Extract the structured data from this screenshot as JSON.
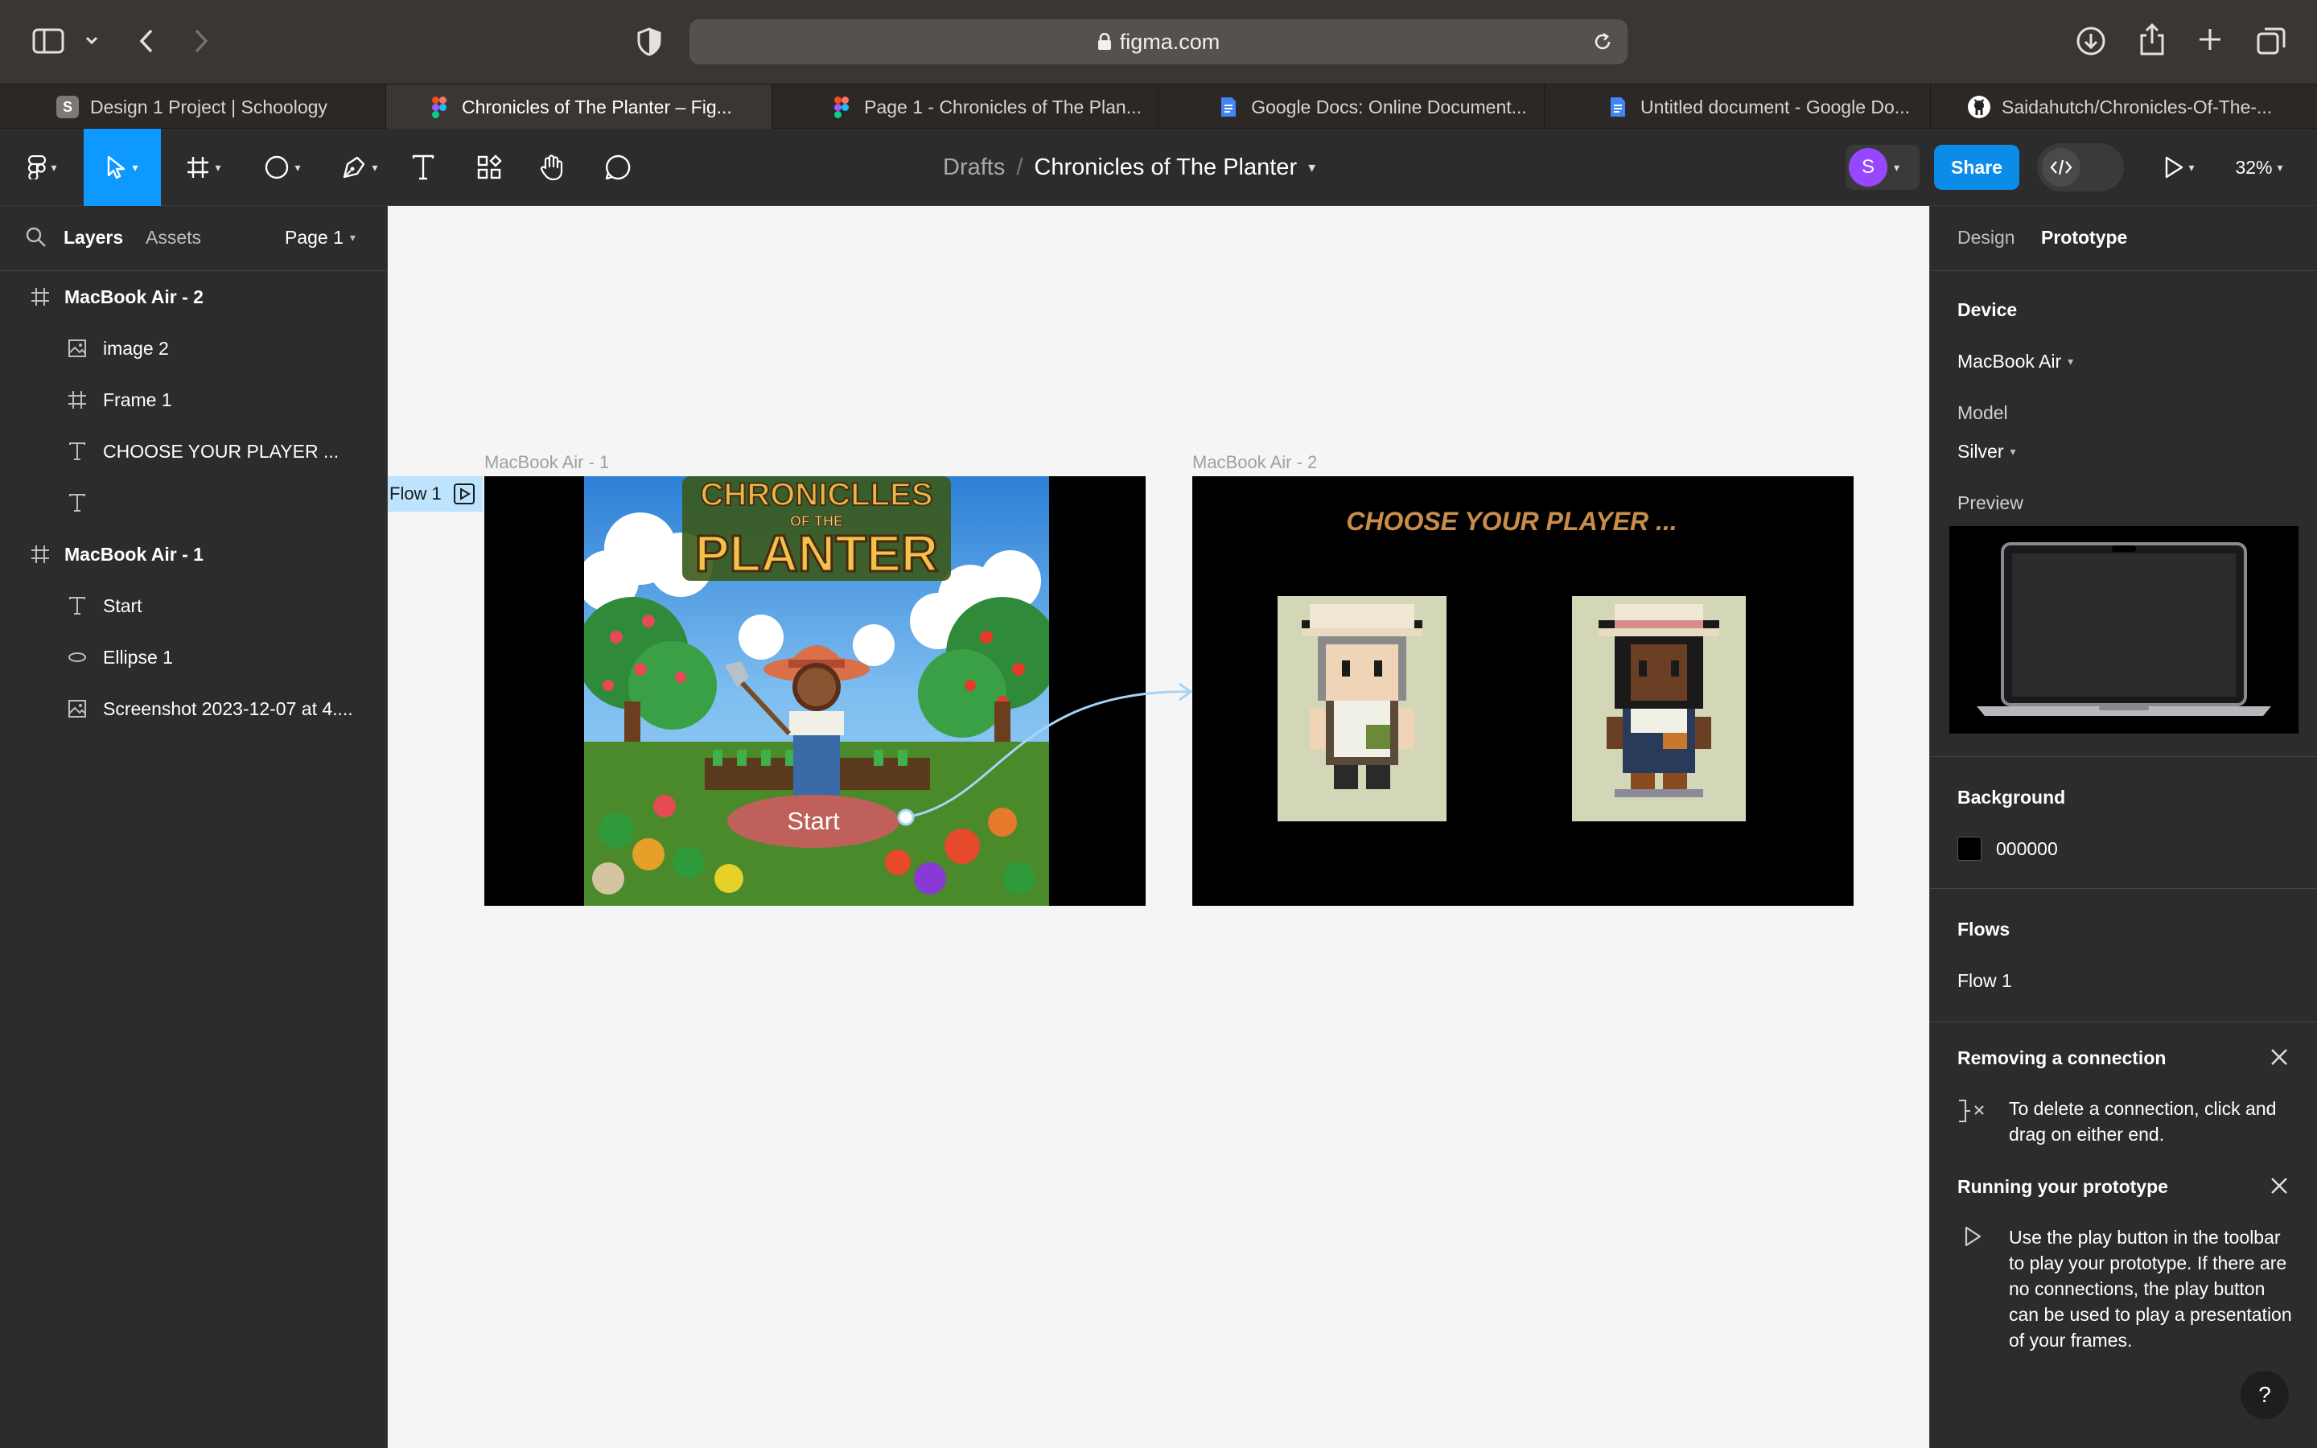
{
  "browser": {
    "url": "figma.com",
    "tabs": [
      {
        "label": "Design 1 Project | Schoology",
        "icon": "schoology-icon",
        "active": false
      },
      {
        "label": "Chronicles of The Planter – Fig...",
        "icon": "figma-icon",
        "active": true
      },
      {
        "label": "Page 1 - Chronicles of The Plan...",
        "icon": "figma-icon",
        "active": false
      },
      {
        "label": "Google Docs: Online Document...",
        "icon": "google-docs-icon",
        "active": false
      },
      {
        "label": "Untitled document - Google Do...",
        "icon": "google-docs-icon",
        "active": false
      },
      {
        "label": "Saidahutch/Chronicles-Of-The-...",
        "icon": "github-icon",
        "active": false
      }
    ]
  },
  "toolbar": {
    "breadcrumb_root": "Drafts",
    "breadcrumb_sep": "/",
    "file_name": "Chronicles of The Planter",
    "avatar_letter": "S",
    "share_label": "Share",
    "zoom": "32%"
  },
  "left_panel": {
    "tab_layers": "Layers",
    "tab_assets": "Assets",
    "page_selector": "Page 1",
    "layers": [
      {
        "name": "MacBook Air - 2",
        "type": "frame",
        "indent": 0
      },
      {
        "name": "image 2",
        "type": "image",
        "indent": 1
      },
      {
        "name": "Frame 1",
        "type": "frame",
        "indent": 1
      },
      {
        "name": "CHOOSE YOUR PLAYER ...",
        "type": "text",
        "indent": 1
      },
      {
        "name": "",
        "type": "text",
        "indent": 1
      },
      {
        "name": "MacBook Air - 1",
        "type": "frame",
        "indent": 0
      },
      {
        "name": "Start",
        "type": "text",
        "indent": 1
      },
      {
        "name": "Ellipse 1",
        "type": "ellipse",
        "indent": 1
      },
      {
        "name": "Screenshot 2023-12-07 at 4....",
        "type": "image",
        "indent": 1
      }
    ]
  },
  "canvas": {
    "frame1_label": "MacBook Air - 1",
    "frame2_label": "MacBook Air - 2",
    "flow_badge": "Flow 1",
    "start_button": "Start",
    "title_line1": "CHRONICLLES",
    "title_line2": "OF THE",
    "title_line3": "PLANTER",
    "choose_heading": "CHOOSE YOUR PLAYER ..."
  },
  "right_panel": {
    "tab_design": "Design",
    "tab_prototype": "Prototype",
    "device_heading": "Device",
    "device_value": "MacBook Air",
    "model_heading": "Model",
    "model_value": "Silver",
    "preview_heading": "Preview",
    "background_heading": "Background",
    "background_value": "000000",
    "flows_heading": "Flows",
    "flow_item": "Flow 1",
    "tip1_title": "Removing a connection",
    "tip1_body": "To delete a connection, click and drag on either end.",
    "tip2_title": "Running your prototype",
    "tip2_body": "Use the play button in the toolbar to play your prototype. If there are no connections, the play button can be used to play a presentation of your frames.",
    "help": "?"
  },
  "colors": {
    "figma_blue": "#0d99ff",
    "share_blue": "#0c8ce9",
    "avatar_purple": "#9747ff",
    "start_pill": "#c0605a",
    "choose_text": "#c98d4a",
    "flow_badge_bg": "#bde3ff"
  }
}
